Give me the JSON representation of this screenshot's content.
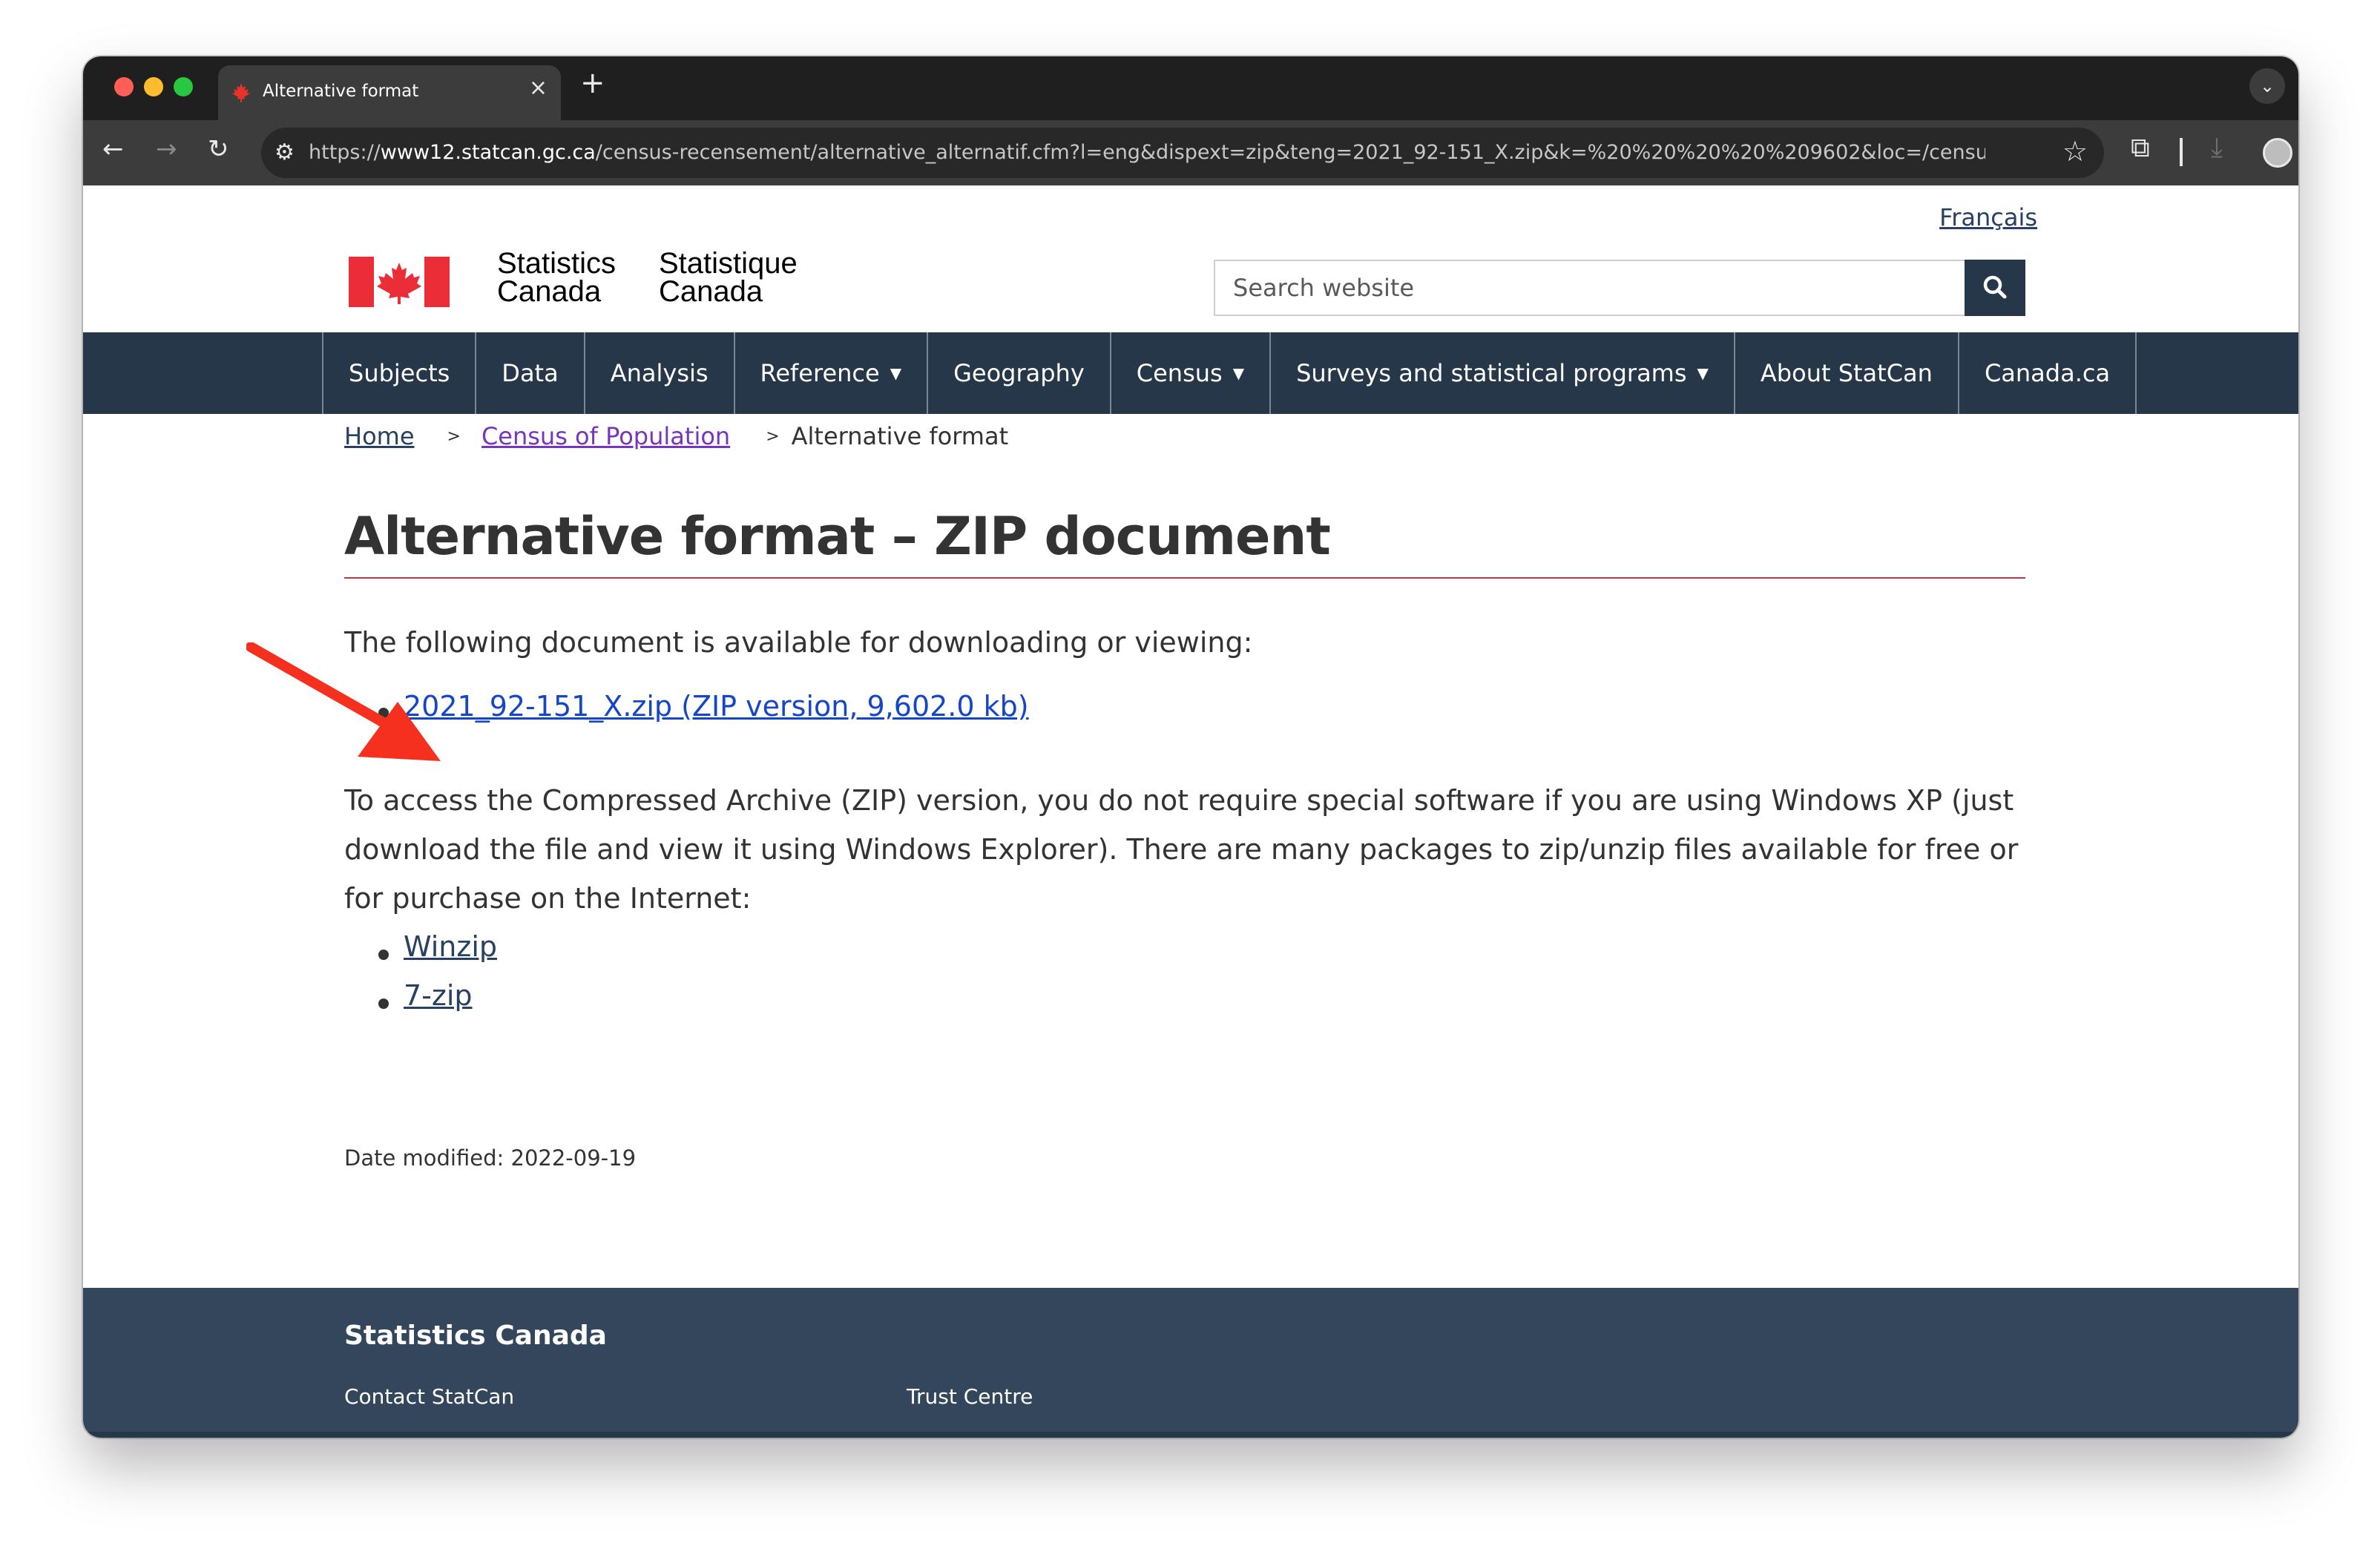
{
  "browser": {
    "tab_title": "Alternative format",
    "url_prefix": "https://",
    "url_host": "www12.statcan.gc.ca",
    "url_path": "/census-recensement/alternative_alternatif.cfm?l=eng&dispext=zip&teng=2021_92-151_X.zip&k=%20%20%20%20%209602&loc=/censu...",
    "new_tab_icon": "plus-icon",
    "close_icon": "close-icon"
  },
  "header": {
    "language_link": "Français",
    "wordmark_en_line1": "Statistics",
    "wordmark_en_line2": "Canada",
    "wordmark_fr_line1": "Statistique",
    "wordmark_fr_line2": "Canada",
    "search_placeholder": "Search website"
  },
  "nav": {
    "items": [
      {
        "label": "Subjects"
      },
      {
        "label": "Data"
      },
      {
        "label": "Analysis"
      },
      {
        "label": "Reference"
      },
      {
        "label": "Geography"
      },
      {
        "label": "Census"
      },
      {
        "label": "Surveys and statistical programs"
      },
      {
        "label": "About StatCan"
      },
      {
        "label": "Canada.ca"
      }
    ]
  },
  "breadcrumb": {
    "home": "Home",
    "census": "Census of Population",
    "sep": ">",
    "current": "Alternative format"
  },
  "main": {
    "title": "Alternative format – ZIP document",
    "intro": "The following document is available for downloading or viewing:",
    "document_link": "2021_92-151_X.zip (ZIP version, 9,602.0 kb)",
    "paragraph": "To access the Compressed Archive (ZIP) version, you do not require special software if you are using Windows XP (just download the file and view it using Windows Explorer). There are many packages to zip/unzip files available for free or for purchase on the Internet:",
    "software_links": [
      "Winzip",
      "7-zip"
    ],
    "date_modified": "Date modified: 2022-09-19"
  },
  "footer": {
    "title": "Statistics Canada",
    "links": [
      "Contact StatCan",
      "Trust Centre"
    ]
  },
  "colors": {
    "nav_bg": "#26374a",
    "footer_bg": "#33465c",
    "title_rule": "#af3c43",
    "doc_link": "#1545c9",
    "annotation_arrow": "#f5301f"
  }
}
